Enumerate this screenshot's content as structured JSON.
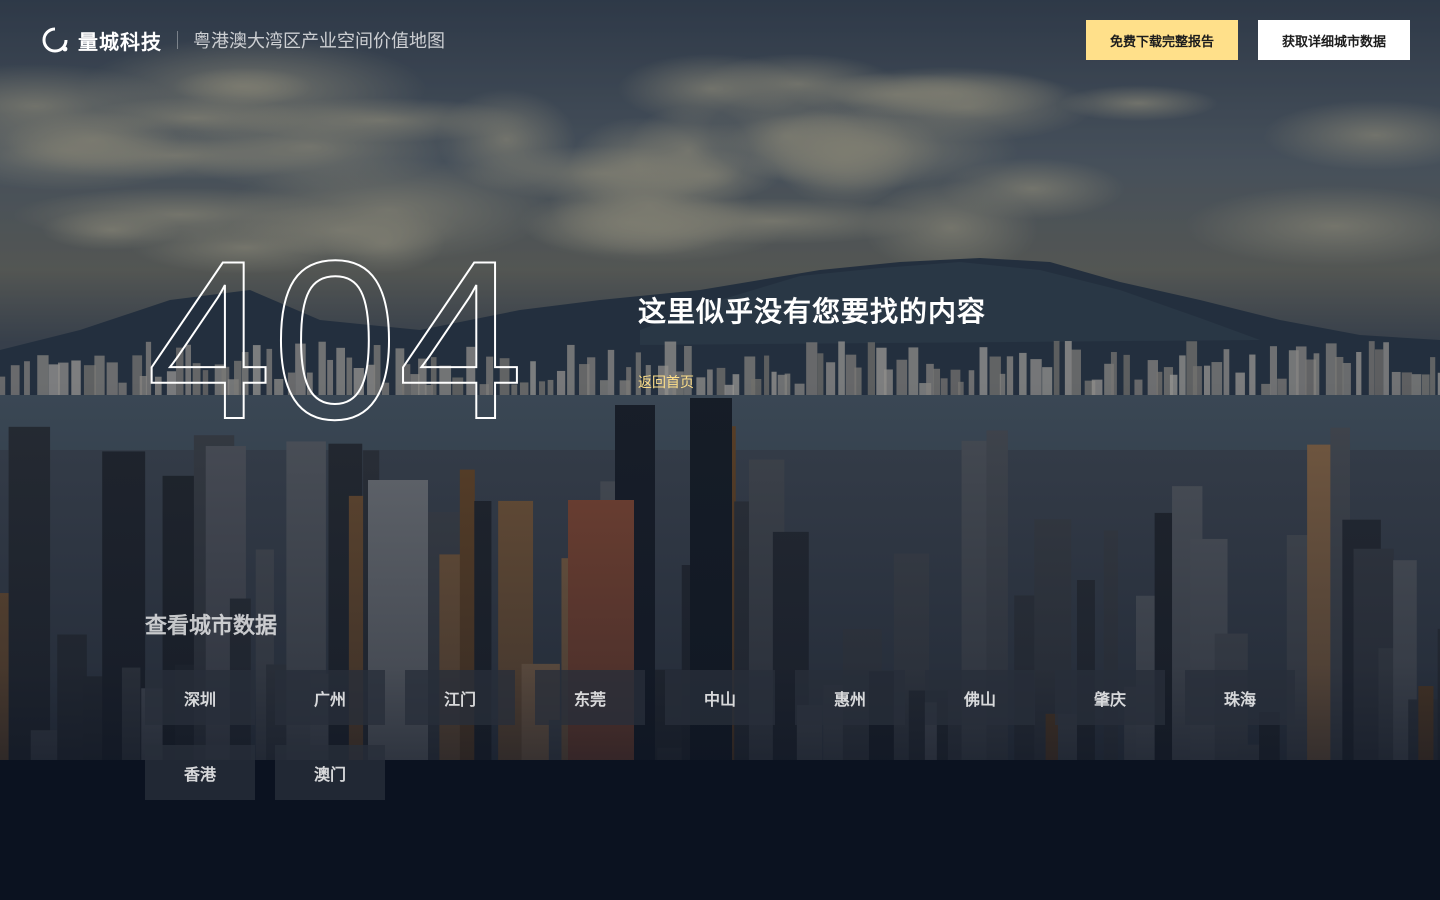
{
  "header": {
    "brand": "量城科技",
    "subtitle": "粤港澳大湾区产业空间价值地图",
    "download_button": "免费下载完整报告",
    "city_data_button": "获取详细城市数据"
  },
  "error": {
    "code": "404",
    "message": "这里似乎没有您要找的内容",
    "home_link": "返回首页"
  },
  "cities": {
    "title": "查看城市数据",
    "items": [
      "深圳",
      "广州",
      "江门",
      "东莞",
      "中山",
      "惠州",
      "佛山",
      "肇庆",
      "珠海",
      "香港",
      "澳门"
    ]
  },
  "colors": {
    "accent": "#ffe08a",
    "background": "#0b1220"
  }
}
